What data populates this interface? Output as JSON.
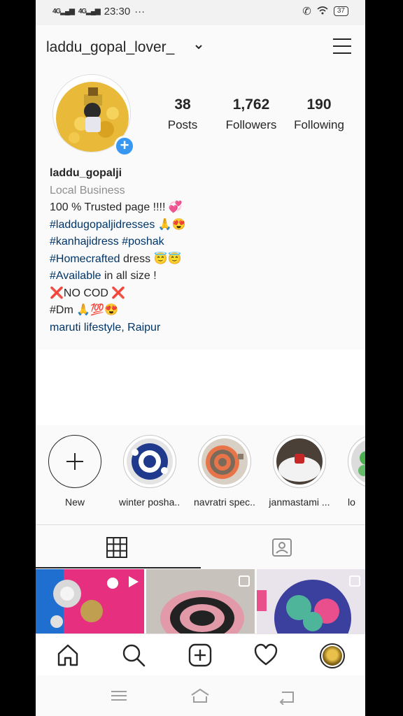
{
  "status_bar": {
    "signal1": "4G",
    "signal2": "4G",
    "time": "23:30",
    "dots": "···",
    "battery": "37"
  },
  "header": {
    "username": "laddu_gopal_lover_"
  },
  "profile": {
    "stats": [
      {
        "value": "38",
        "label": "Posts"
      },
      {
        "value": "1,762",
        "label": "Followers"
      },
      {
        "value": "190",
        "label": "Following"
      }
    ],
    "display_name": "laddu_gopalji",
    "category": "Local Business",
    "bio": {
      "line1": "100 % Trusted page !!!! 💞",
      "line2_tag": "#laddugopaljidresses",
      "line2_emoji": " 🙏😍",
      "line3_tag1": "#kanhajidress",
      "line3_tag2": "#poshak",
      "line4_tag": "#Homecrafted",
      "line4_text": " dress 😇😇",
      "line5_tag": "#Available",
      "line5_text": " in all size !",
      "line6": "❌NO COD ❌",
      "line7": "#Dm 🙏💯😍",
      "location": "maruti lifestyle, Raipur"
    }
  },
  "highlights": [
    {
      "label": "New"
    },
    {
      "label": "winter posha..."
    },
    {
      "label": "navratri spec..."
    },
    {
      "label": "janmastami ..."
    },
    {
      "label": "lo"
    }
  ],
  "colors": {
    "accent_blue": "#3897f0",
    "hashtag": "#003569",
    "muted": "#8e8e8e"
  }
}
